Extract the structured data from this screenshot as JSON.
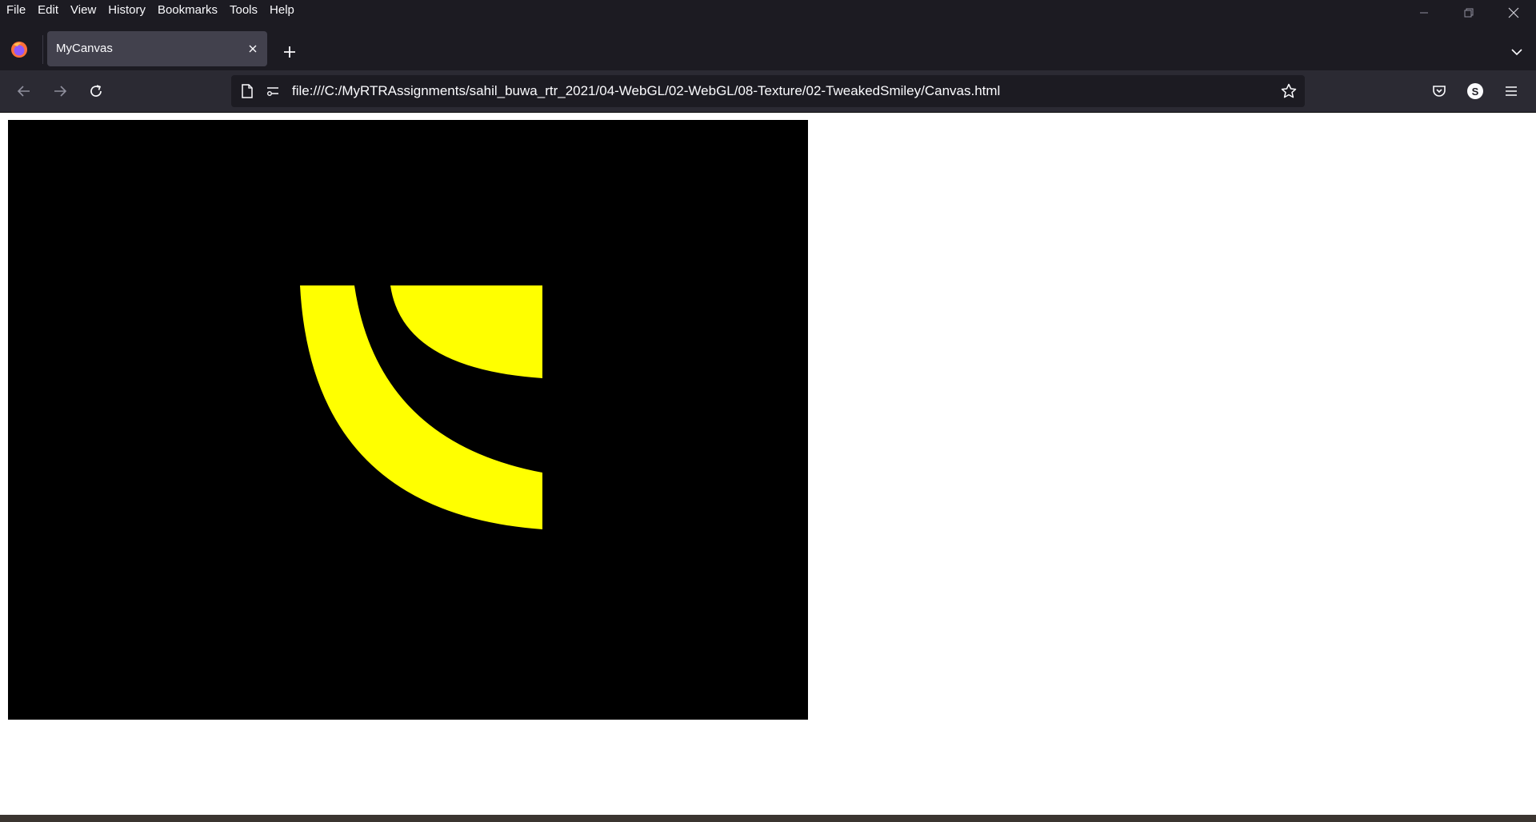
{
  "menu": [
    "File",
    "Edit",
    "View",
    "History",
    "Bookmarks",
    "Tools",
    "Help"
  ],
  "tab": {
    "title": "MyCanvas"
  },
  "urlbar": {
    "url": "file:///C:/MyRTRAssignments/sahil_buwa_rtr_2021/04-WebGL/02-WebGL/08-Texture/02-TweakedSmiley/Canvas.html"
  },
  "account": {
    "initial": "S"
  },
  "colors": {
    "chrome_dark": "#1c1b22",
    "toolbar": "#2b2a33",
    "tab_active": "#42414d",
    "canvas_bg": "#000000",
    "shape_fill": "#ffff00"
  },
  "icons": [
    "firefox-icon",
    "close-icon",
    "plus-icon",
    "chevron-down-icon",
    "back-icon",
    "forward-icon",
    "reload-icon",
    "page-icon",
    "permissions-icon",
    "star-icon",
    "pocket-icon",
    "menu-icon",
    "minimize-icon",
    "restore-icon"
  ]
}
